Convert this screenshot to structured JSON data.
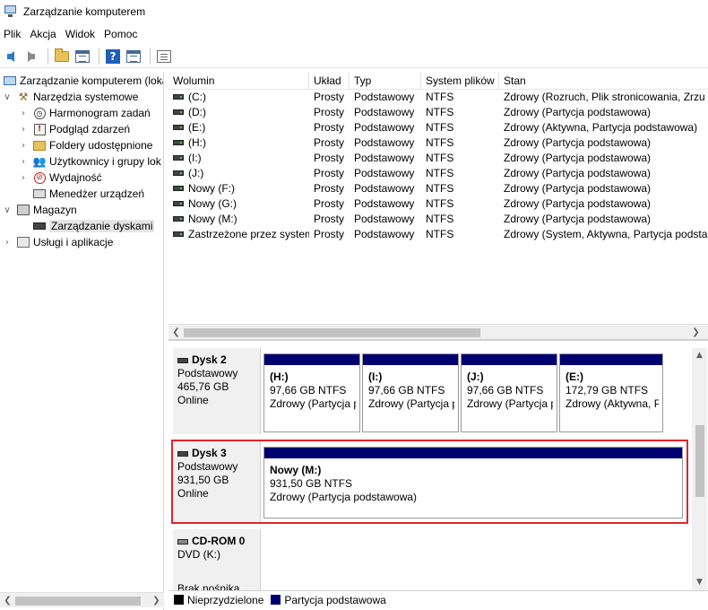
{
  "window": {
    "title": "Zarządzanie komputerem"
  },
  "menu": [
    "Plik",
    "Akcja",
    "Widok",
    "Pomoc"
  ],
  "tree": {
    "items": [
      {
        "label": "Zarządzanie komputerem (loka",
        "expander": "",
        "icon": "computer-icon",
        "level": 0
      },
      {
        "label": "Narzędzia systemowe",
        "expander": "∨",
        "icon": "tools-icon",
        "level": 1
      },
      {
        "label": "Harmonogram zadań",
        "expander": "›",
        "icon": "clock-icon",
        "level": 2
      },
      {
        "label": "Podgląd zdarzeń",
        "expander": "›",
        "icon": "event-viewer-icon",
        "level": 2
      },
      {
        "label": "Foldery udostępnione",
        "expander": "›",
        "icon": "shared-folder-icon",
        "level": 2
      },
      {
        "label": "Użytkownicy i grupy lok",
        "expander": "›",
        "icon": "users-icon",
        "level": 2
      },
      {
        "label": "Wydajność",
        "expander": "›",
        "icon": "performance-icon",
        "level": 2
      },
      {
        "label": "Menedżer urządzeń",
        "expander": "",
        "icon": "device-manager-icon",
        "level": 2
      },
      {
        "label": "Magazyn",
        "expander": "∨",
        "icon": "storage-icon",
        "level": 1
      },
      {
        "label": "Zarządzanie dyskami",
        "expander": "",
        "icon": "disk-management-icon",
        "level": 2,
        "selected": true
      },
      {
        "label": "Usługi i aplikacje",
        "expander": "›",
        "icon": "services-icon",
        "level": 1
      }
    ]
  },
  "volumes": {
    "columns": [
      "Wolumin",
      "Układ",
      "Typ",
      "System plików",
      "Stan"
    ],
    "rows": [
      [
        "(C:)",
        "Prosty",
        "Podstawowy",
        "NTFS",
        "Zdrowy (Rozruch, Plik stronicowania, Zrzu"
      ],
      [
        "(D:)",
        "Prosty",
        "Podstawowy",
        "NTFS",
        "Zdrowy (Partycja podstawowa)"
      ],
      [
        "(E:)",
        "Prosty",
        "Podstawowy",
        "NTFS",
        "Zdrowy (Aktywna, Partycja podstawowa)"
      ],
      [
        "(H:)",
        "Prosty",
        "Podstawowy",
        "NTFS",
        "Zdrowy (Partycja podstawowa)"
      ],
      [
        "(I:)",
        "Prosty",
        "Podstawowy",
        "NTFS",
        "Zdrowy (Partycja podstawowa)"
      ],
      [
        "(J:)",
        "Prosty",
        "Podstawowy",
        "NTFS",
        "Zdrowy (Partycja podstawowa)"
      ],
      [
        "Nowy (F:)",
        "Prosty",
        "Podstawowy",
        "NTFS",
        "Zdrowy (Partycja podstawowa)"
      ],
      [
        "Nowy (G:)",
        "Prosty",
        "Podstawowy",
        "NTFS",
        "Zdrowy (Partycja podstawowa)"
      ],
      [
        "Nowy (M:)",
        "Prosty",
        "Podstawowy",
        "NTFS",
        "Zdrowy (Partycja podstawowa)"
      ],
      [
        "Zastrzeżone przez system",
        "Prosty",
        "Podstawowy",
        "NTFS",
        "Zdrowy (System, Aktywna, Partycja podsta"
      ]
    ]
  },
  "disks": [
    {
      "name": "Dysk 2",
      "type": "Podstawowy",
      "size": "465,76 GB",
      "status": "Online",
      "partitions": [
        {
          "name": "(H:)",
          "size": "97,66 GB NTFS",
          "status": "Zdrowy (Partycja p"
        },
        {
          "name": "(I:)",
          "size": "97,66 GB NTFS",
          "status": "Zdrowy (Partycja p"
        },
        {
          "name": "(J:)",
          "size": "97,66 GB NTFS",
          "status": "Zdrowy (Partycja p"
        },
        {
          "name": "(E:)",
          "size": "172,79 GB NTFS",
          "status": "Zdrowy (Aktywna, P"
        }
      ]
    },
    {
      "name": "Dysk 3",
      "type": "Podstawowy",
      "size": "931,50 GB",
      "status": "Online",
      "partitions": [
        {
          "name": "Nowy  (M:)",
          "size": "931,50 GB NTFS",
          "status": "Zdrowy (Partycja podstawowa)"
        }
      ]
    },
    {
      "name": "CD-ROM 0",
      "type": "DVD (K:)",
      "size": "",
      "status": "Brak nośnika",
      "partitions": []
    }
  ],
  "legend": [
    {
      "label": "Nieprzydzielone",
      "color": "#000000"
    },
    {
      "label": "Partycja podstawowa",
      "color": "#00006e"
    }
  ]
}
